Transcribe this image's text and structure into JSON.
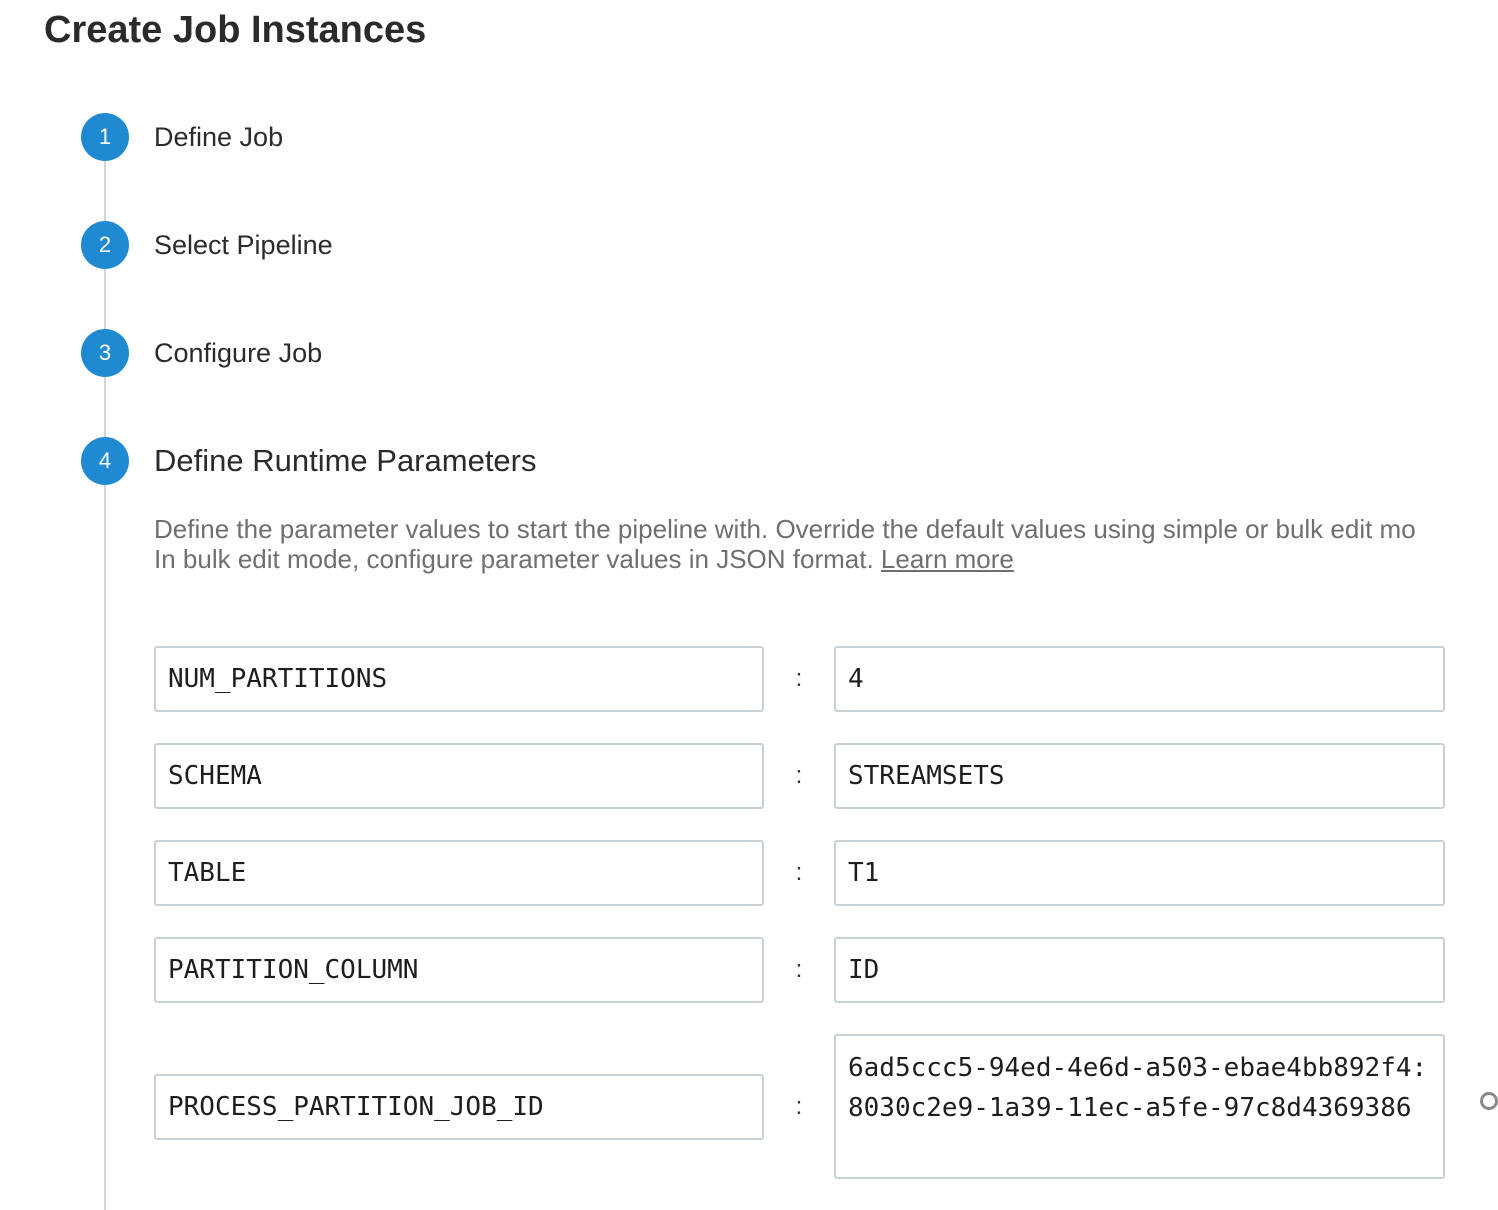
{
  "page": {
    "title": "Create Job Instances"
  },
  "steps": [
    {
      "number": "1",
      "label": "Define Job"
    },
    {
      "number": "2",
      "label": "Select Pipeline"
    },
    {
      "number": "3",
      "label": "Configure Job"
    },
    {
      "number": "4",
      "label": "Define Runtime Parameters"
    }
  ],
  "runtime_params": {
    "description_line1": "Define the parameter values to start the pipeline with. Override the default values using simple or bulk edit mo",
    "description_line2": "In bulk edit mode, configure parameter values in JSON format. ",
    "learn_more": "Learn more",
    "separator": ":",
    "rows": [
      {
        "key": "NUM_PARTITIONS",
        "value": "4"
      },
      {
        "key": "SCHEMA",
        "value": "STREAMSETS"
      },
      {
        "key": "TABLE",
        "value": "T1"
      },
      {
        "key": "PARTITION_COLUMN",
        "value": "ID"
      },
      {
        "key": "PROCESS_PARTITION_JOB_ID",
        "value": "6ad5ccc5-94ed-4e6d-a503-ebae4bb892f4:8030c2e9-1a39-11ec-a5fe-97c8d4369386"
      }
    ]
  },
  "colors": {
    "step_circle": "#1f8ad2",
    "field_border": "#c9d1d8",
    "description_text": "#6f6f6f"
  }
}
